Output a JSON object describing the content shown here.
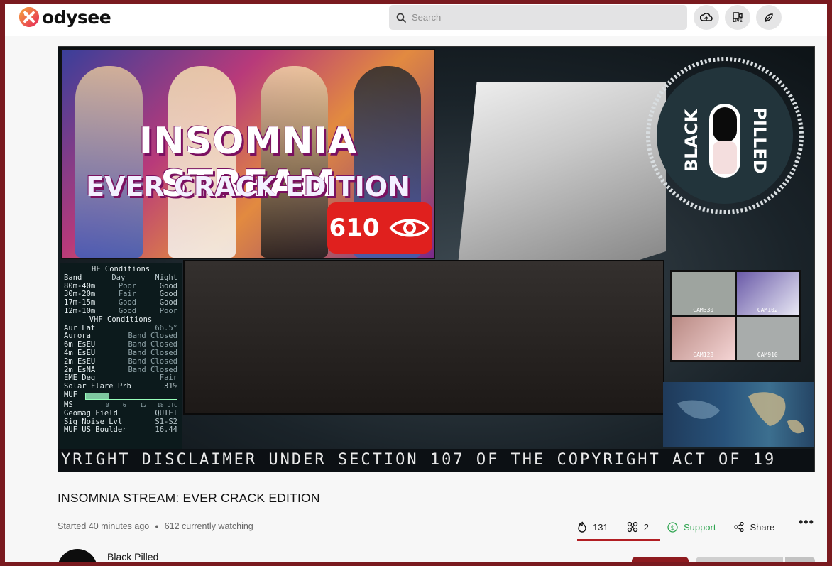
{
  "header": {
    "logo_text": "odysee",
    "search_placeholder": "Search",
    "buttons": [
      "upload-icon",
      "live-icon",
      "publish-icon"
    ],
    "live_label": "LIVE"
  },
  "video": {
    "thumb_title_1": "INSOMNIA STREAM",
    "thumb_title_2": "EVER CRACK EDITION",
    "view_badge": "610",
    "black_pilled_left": "BLACK",
    "black_pilled_right": "PILLED",
    "hf_panel": {
      "title": "HF Conditions",
      "head": [
        "Band",
        "Day",
        "Night"
      ],
      "rows": [
        [
          "80m-40m",
          "Poor",
          "Good"
        ],
        [
          "30m-20m",
          "Fair",
          "Good"
        ],
        [
          "17m-15m",
          "Good",
          "Good"
        ],
        [
          "12m-10m",
          "Good",
          "Poor"
        ]
      ],
      "vhf_title": "VHF Conditions",
      "vhf_rows": [
        [
          "Aur Lat",
          "66.5°"
        ],
        [
          "Aurora",
          "Band Closed"
        ],
        [
          "6m EsEU",
          "Band Closed"
        ],
        [
          "4m EsEU",
          "Band Closed"
        ],
        [
          "2m EsEU",
          "Band Closed"
        ],
        [
          "2m EsNA",
          "Band Closed"
        ],
        [
          "EME Deg",
          "Fair"
        ],
        [
          "Solar Flare Prb",
          "31%"
        ]
      ],
      "muf_label": "MUF",
      "muf_level": 0.25,
      "ms_label": "MS",
      "ms_scale": "0    6    12   18 UTC",
      "footer": [
        [
          "Geomag Field",
          "QUIET"
        ],
        [
          "Sig Noise Lvl",
          "S1-S2"
        ],
        [
          "MUF US Boulder",
          "16.44"
        ]
      ]
    },
    "cams": [
      "CAM330",
      "CAM102",
      "CAM128",
      "CAM910"
    ],
    "ticker": "YRIGHT DISCLAIMER UNDER SECTION 107 OF THE COPYRIGHT ACT OF 19"
  },
  "title": "INSOMNIA STREAM: EVER CRACK EDITION",
  "meta": {
    "started": "Started 40 minutes ago",
    "watching": "612 currently watching"
  },
  "actions": {
    "fire_count": "131",
    "slime_count": "2",
    "support_label": "Support",
    "share_label": "Share",
    "more_label": "•••"
  },
  "channel": {
    "name": "Black Pilled"
  },
  "colors": {
    "accent": "#b21e23",
    "support": "#2ea44f",
    "page_border": "#7a1a1f"
  }
}
